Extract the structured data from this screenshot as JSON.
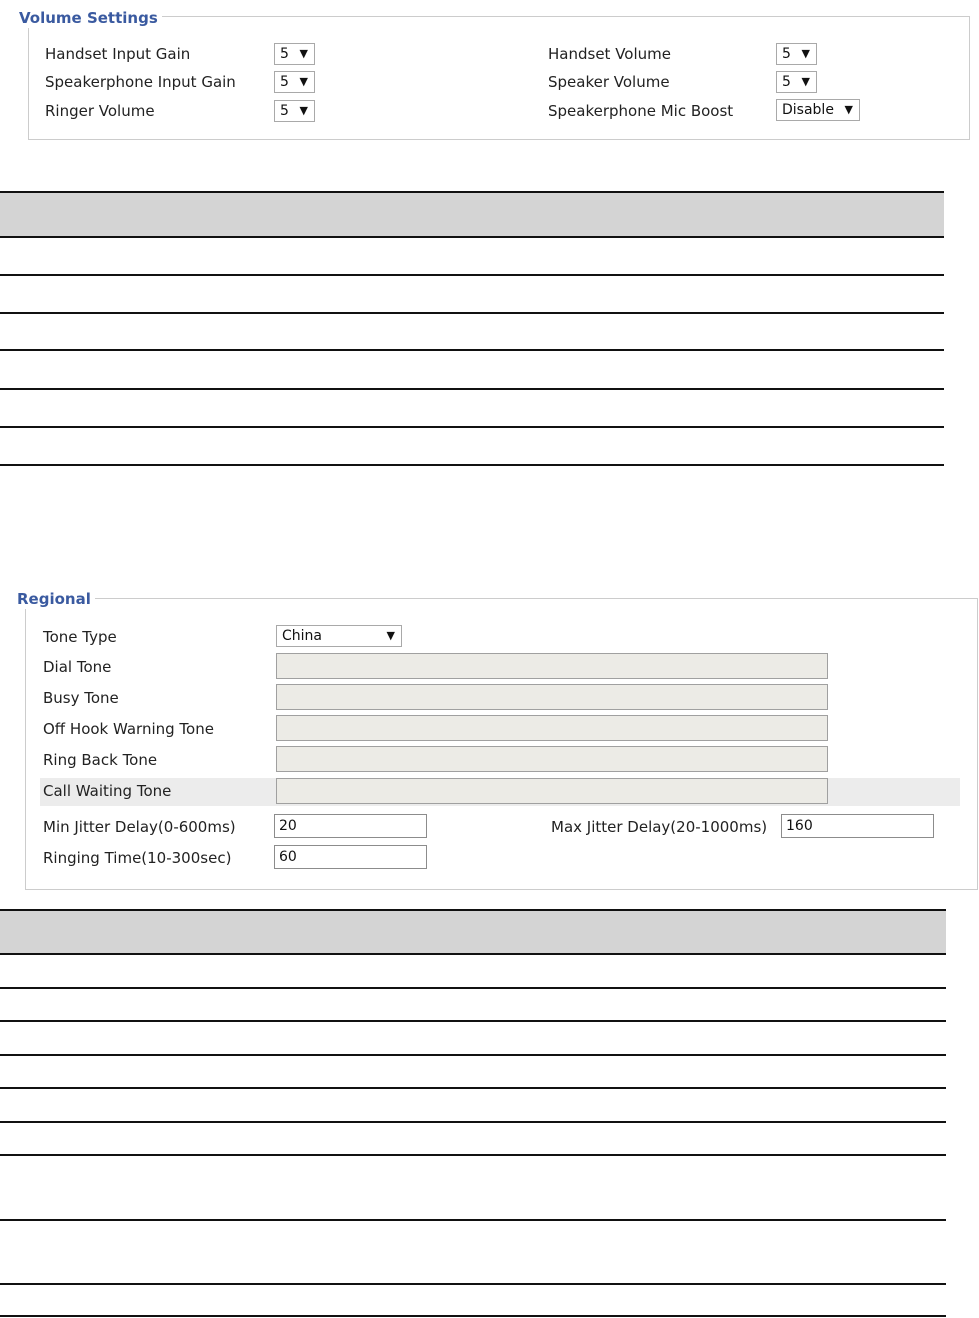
{
  "volume_settings": {
    "legend": "Volume Settings",
    "left": [
      {
        "label": "Handset Input Gain",
        "value": "5"
      },
      {
        "label": "Speakerphone Input Gain",
        "value": "5"
      },
      {
        "label": "Ringer Volume",
        "value": "5"
      }
    ],
    "right": [
      {
        "label": "Handset Volume",
        "value": "5"
      },
      {
        "label": "Speaker Volume",
        "value": "5"
      },
      {
        "label": "Speakerphone Mic Boost",
        "value": "Disable"
      }
    ]
  },
  "regional": {
    "legend": "Regional",
    "tone_type_label": "Tone Type",
    "tone_type_value": "China",
    "tones": [
      {
        "label": "Dial Tone",
        "value": ""
      },
      {
        "label": "Busy Tone",
        "value": ""
      },
      {
        "label": "Off Hook Warning Tone",
        "value": ""
      },
      {
        "label": "Ring Back Tone",
        "value": ""
      },
      {
        "label": "Call Waiting Tone",
        "value": ""
      }
    ],
    "min_jitter_label": "Min Jitter Delay(0-600ms)",
    "min_jitter_value": "20",
    "max_jitter_label": "Max Jitter Delay(20-1000ms)",
    "max_jitter_value": "160",
    "ringing_time_label": "Ringing Time(10-300sec)",
    "ringing_time_value": "60"
  },
  "icons": {
    "dropdown_arrow": "▼"
  },
  "colors": {
    "legend": "#3a5aa0",
    "table_header": "#d4d4d4",
    "tone_field": "#ecebe6",
    "highlight_row": "#ececec"
  }
}
